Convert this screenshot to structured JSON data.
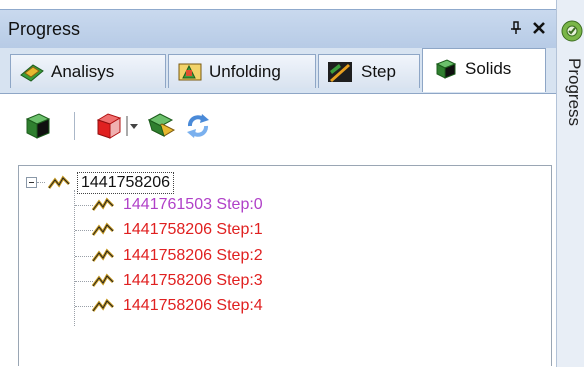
{
  "window": {
    "title": "Progress"
  },
  "titlebar_buttons": {
    "pin": "ᵖ",
    "close": "×"
  },
  "tabs": [
    {
      "label": "Analisys",
      "icon": "analysis-icon"
    },
    {
      "label": "Unfolding",
      "icon": "unfolding-icon"
    },
    {
      "label": "Step",
      "icon": "step-icon"
    },
    {
      "label": "Solids",
      "icon": "solids-icon",
      "active": true
    }
  ],
  "toolbar": {
    "buttons": [
      "solid-select-icon",
      "red-cube-icon",
      "dropdown-arrow-icon",
      "flatten-icon",
      "refresh-icon"
    ]
  },
  "tree": {
    "root": "1441758206",
    "children": [
      {
        "label": "1441761503 Step:0",
        "color": "#b040c8"
      },
      {
        "label": "1441758206 Step:1",
        "color": "#e02020"
      },
      {
        "label": "1441758206 Step:2",
        "color": "#e02020"
      },
      {
        "label": "1441758206 Step:3",
        "color": "#e02020"
      },
      {
        "label": "1441758206 Step:4",
        "color": "#e02020"
      }
    ]
  },
  "right_panel": {
    "label": "Progress"
  }
}
